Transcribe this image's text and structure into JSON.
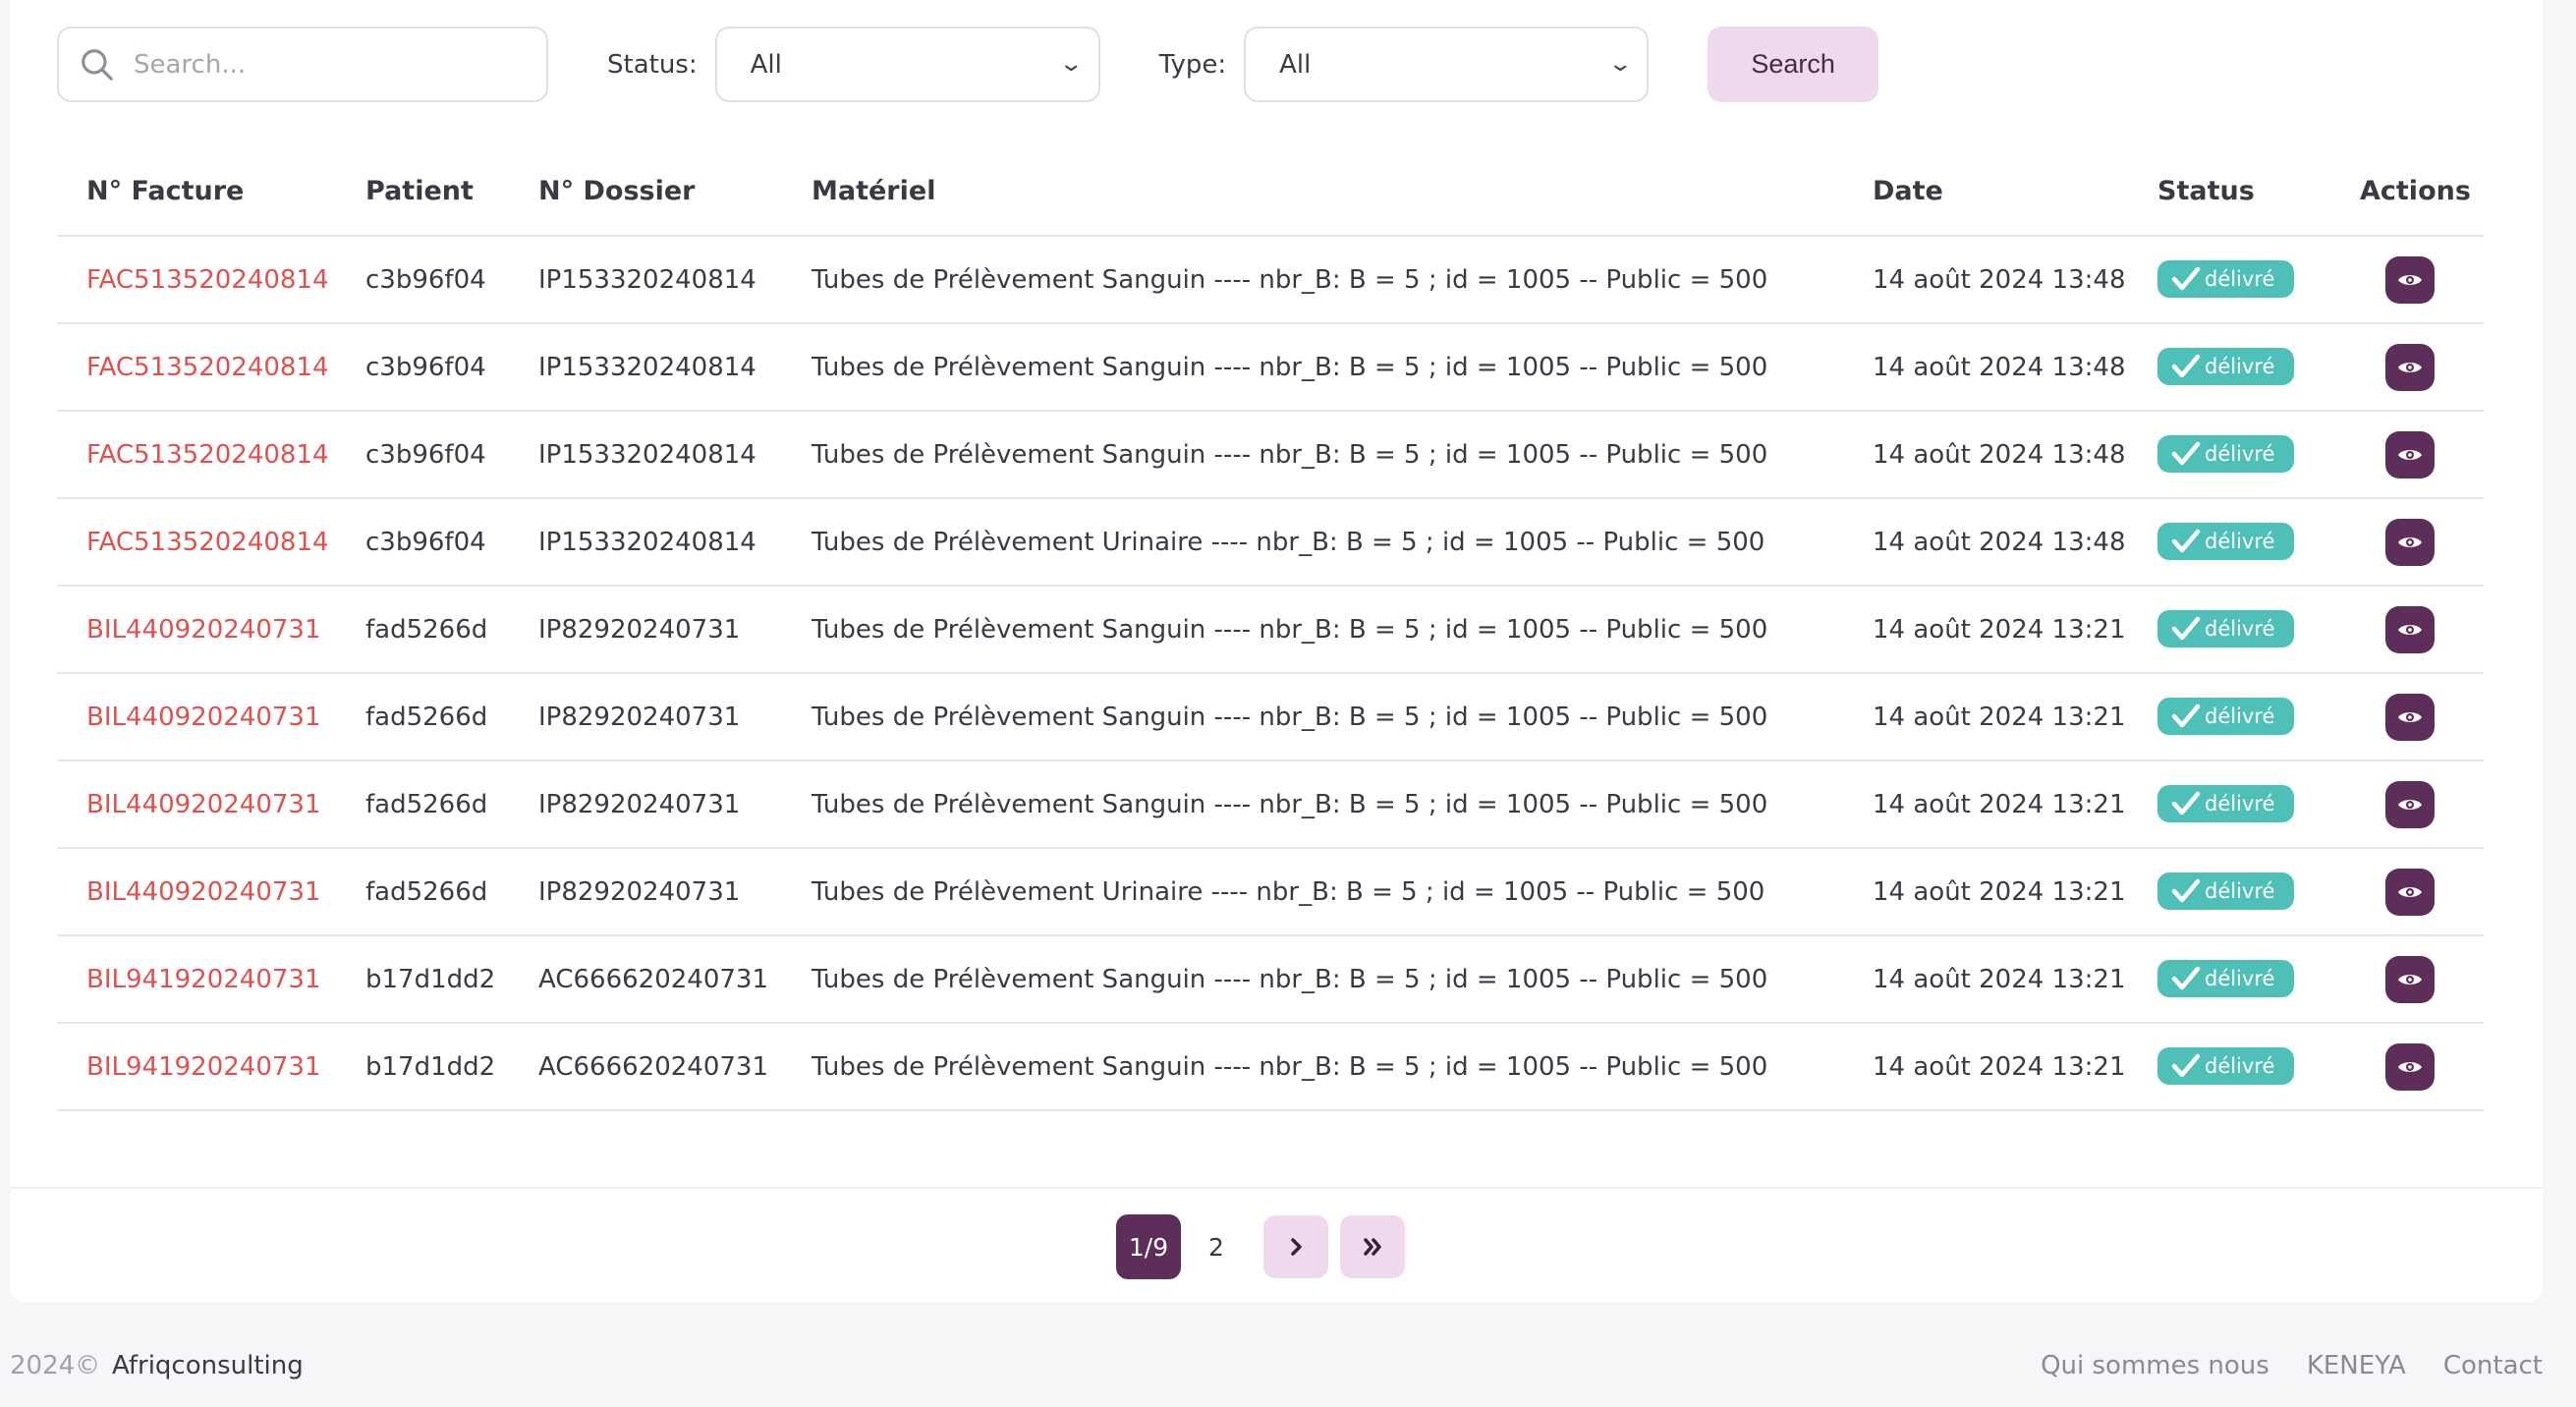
{
  "filters": {
    "search_placeholder": "Search...",
    "status_label": "Status:",
    "status_value": "All",
    "type_label": "Type:",
    "type_value": "All",
    "search_button": "Search"
  },
  "table": {
    "headers": [
      "N° Facture",
      "Patient",
      "N° Dossier",
      "Matériel",
      "Date",
      "Status",
      "Actions"
    ],
    "rows": [
      {
        "facture": "FAC513520240814",
        "patient": "c3b96f04",
        "dossier": "IP153320240814",
        "materiel": "Tubes de Prélèvement Sanguin ---- nbr_B: B = 5 ; id = 1005 -- Public = 500",
        "date": "14 août 2024 13:48",
        "status": "délivré"
      },
      {
        "facture": "FAC513520240814",
        "patient": "c3b96f04",
        "dossier": "IP153320240814",
        "materiel": "Tubes de Prélèvement Sanguin ---- nbr_B: B = 5 ; id = 1005 -- Public = 500",
        "date": "14 août 2024 13:48",
        "status": "délivré"
      },
      {
        "facture": "FAC513520240814",
        "patient": "c3b96f04",
        "dossier": "IP153320240814",
        "materiel": "Tubes de Prélèvement Sanguin ---- nbr_B: B = 5 ; id = 1005 -- Public = 500",
        "date": "14 août 2024 13:48",
        "status": "délivré"
      },
      {
        "facture": "FAC513520240814",
        "patient": "c3b96f04",
        "dossier": "IP153320240814",
        "materiel": "Tubes de Prélèvement Urinaire ---- nbr_B: B = 5 ; id = 1005 -- Public = 500",
        "date": "14 août 2024 13:48",
        "status": "délivré"
      },
      {
        "facture": "BIL440920240731",
        "patient": "fad5266d",
        "dossier": "IP82920240731",
        "materiel": "Tubes de Prélèvement Sanguin ---- nbr_B: B = 5 ; id = 1005 -- Public = 500",
        "date": "14 août 2024 13:21",
        "status": "délivré"
      },
      {
        "facture": "BIL440920240731",
        "patient": "fad5266d",
        "dossier": "IP82920240731",
        "materiel": "Tubes de Prélèvement Sanguin ---- nbr_B: B = 5 ; id = 1005 -- Public = 500",
        "date": "14 août 2024 13:21",
        "status": "délivré"
      },
      {
        "facture": "BIL440920240731",
        "patient": "fad5266d",
        "dossier": "IP82920240731",
        "materiel": "Tubes de Prélèvement Sanguin ---- nbr_B: B = 5 ; id = 1005 -- Public = 500",
        "date": "14 août 2024 13:21",
        "status": "délivré"
      },
      {
        "facture": "BIL440920240731",
        "patient": "fad5266d",
        "dossier": "IP82920240731",
        "materiel": "Tubes de Prélèvement Urinaire ---- nbr_B: B = 5 ; id = 1005 -- Public = 500",
        "date": "14 août 2024 13:21",
        "status": "délivré"
      },
      {
        "facture": "BIL941920240731",
        "patient": "b17d1dd2",
        "dossier": "AC666620240731",
        "materiel": "Tubes de Prélèvement Sanguin ---- nbr_B: B = 5 ; id = 1005 -- Public = 500",
        "date": "14 août 2024 13:21",
        "status": "délivré"
      },
      {
        "facture": "BIL941920240731",
        "patient": "b17d1dd2",
        "dossier": "AC666620240731",
        "materiel": "Tubes de Prélèvement Sanguin ---- nbr_B: B = 5 ; id = 1005 -- Public = 500",
        "date": "14 août 2024 13:21",
        "status": "délivré"
      }
    ]
  },
  "pagination": {
    "current": "1/9",
    "next_page": "2"
  },
  "footer": {
    "copyright": "2024©",
    "brand": "Afriqconsulting",
    "links": [
      "Qui sommes nous",
      "KENEYA",
      "Contact"
    ]
  },
  "colors": {
    "accent": "#5c2e59",
    "accent_light": "#efd9ec",
    "status_badge": "#4ec0b7",
    "invoice_link": "#e0504f"
  }
}
